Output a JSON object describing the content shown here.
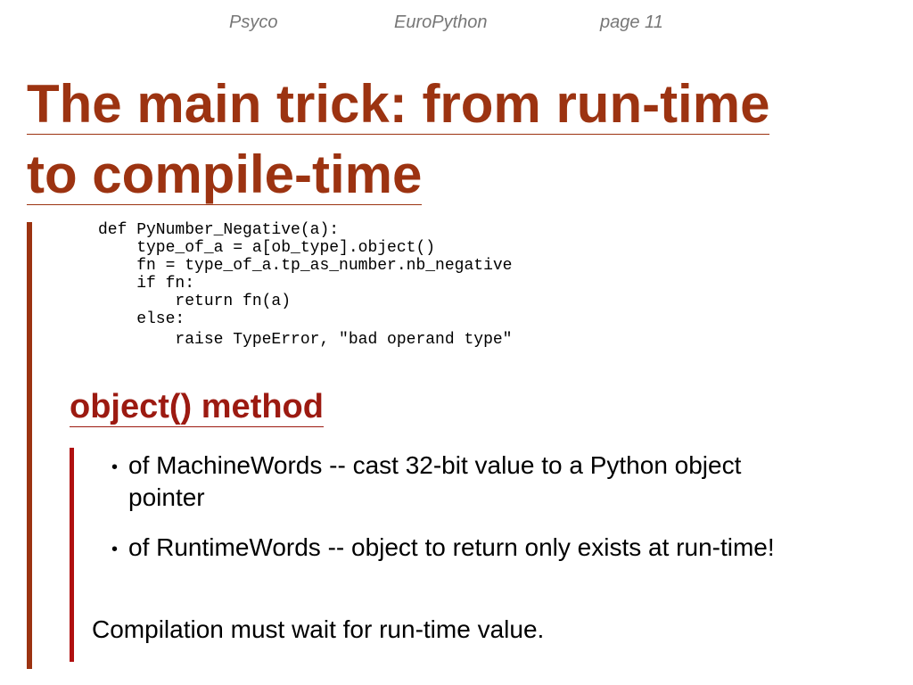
{
  "header": {
    "left": "Psyco",
    "center": "EuroPython",
    "right": "page 11"
  },
  "title": {
    "line1": "The main trick: from run-time",
    "line2": "to compile-time"
  },
  "code": {
    "lines": [
      "def PyNumber_Negative(a):",
      "    type_of_a = a[ob_type].object()",
      "    fn = type_of_a.tp_as_number.nb_negative",
      "    if fn:",
      "        return fn(a)",
      "    else:",
      "        raise TypeError, \"bad operand type\""
    ]
  },
  "subheading": "object() method",
  "bullets": [
    {
      "marker": "•",
      "text": "of MachineWords -- cast 32-bit value to a Python object pointer"
    },
    {
      "marker": "•",
      "text": "of RuntimeWords -- object to return only exists at run-time!"
    }
  ],
  "conclusion": "Compilation must wait for run-time value.",
  "colors": {
    "title": "#9c3311",
    "subheading": "#9c1a11",
    "accent_bar": "#9c3311",
    "inner_bar": "#b01010",
    "header_text": "#777777"
  }
}
